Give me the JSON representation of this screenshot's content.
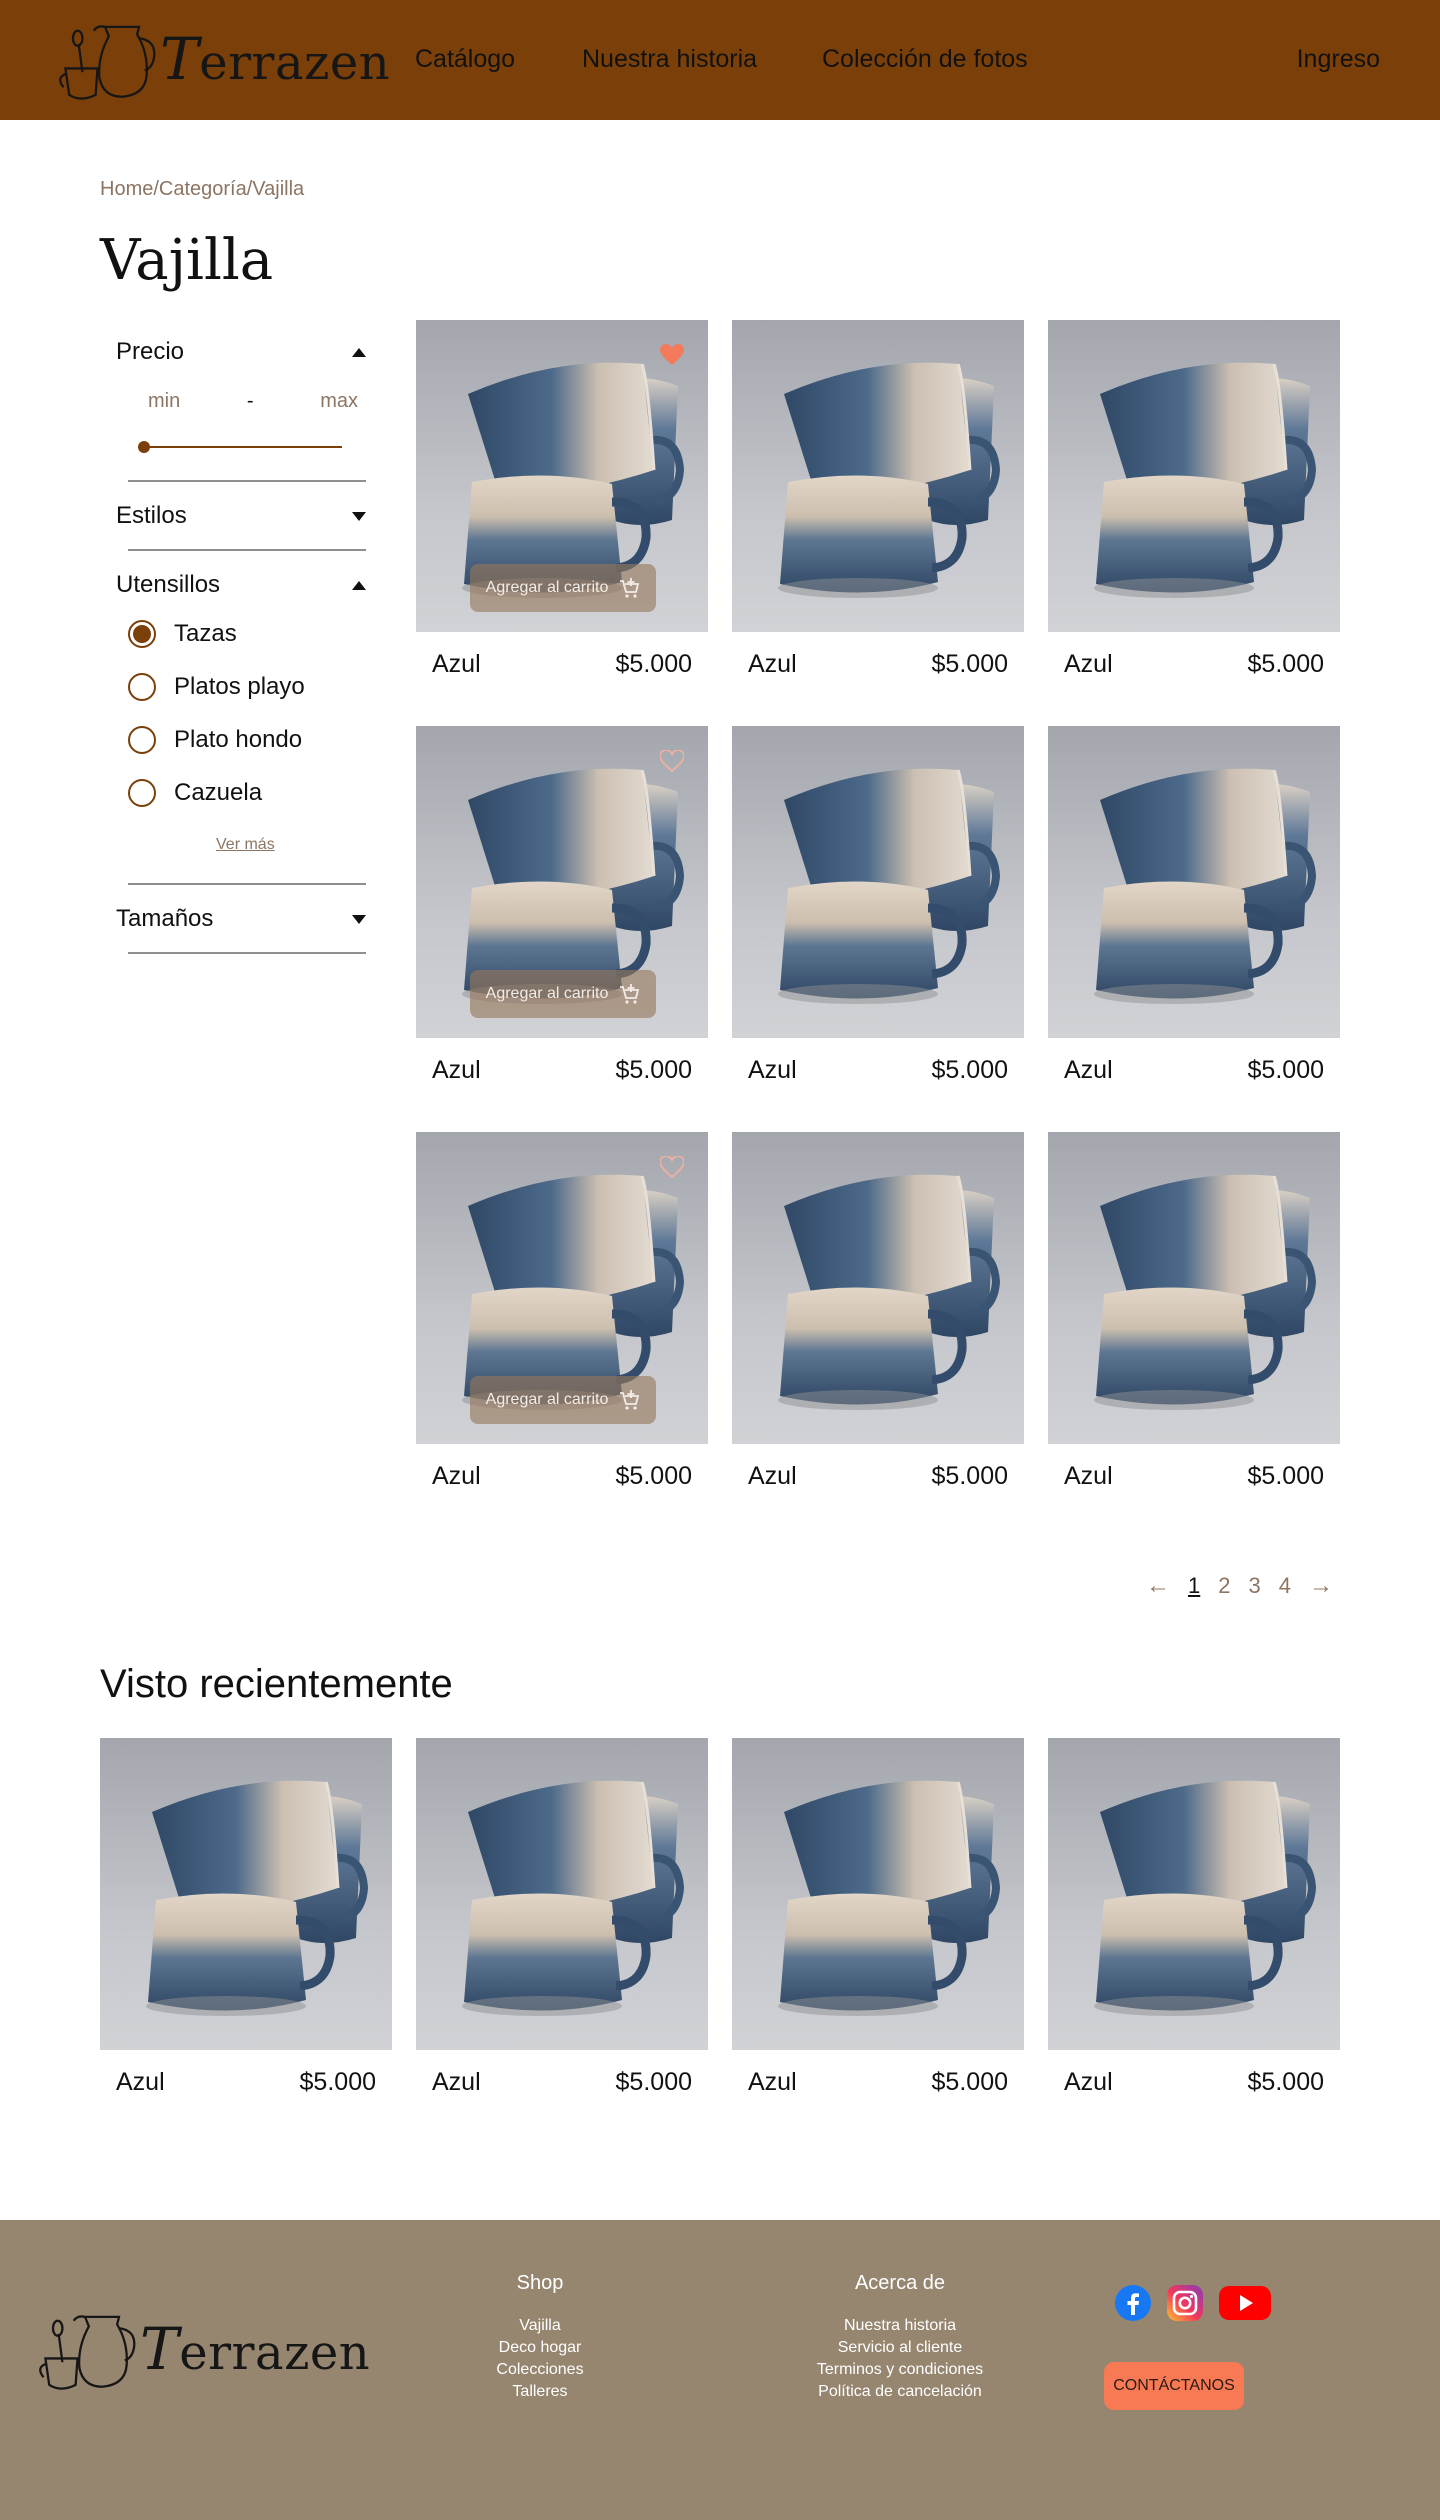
{
  "header": {
    "brand": "Terrazen",
    "nav": [
      "Catálogo",
      "Nuestra historia",
      "Colección de fotos"
    ],
    "login": "Ingreso"
  },
  "breadcrumb": [
    "Home/",
    "Categoría/",
    "Vajilla"
  ],
  "page_title": "Vajilla",
  "filters": {
    "price": {
      "label": "Precio",
      "min_placeholder": "min",
      "separator": "-",
      "max_placeholder": "max"
    },
    "styles": {
      "label": "Estilos"
    },
    "utensils": {
      "label": "Utensillos",
      "options": [
        "Tazas",
        "Platos playo",
        "Plato hondo",
        "Cazuela"
      ],
      "selected": "Tazas",
      "more": "Ver más"
    },
    "sizes": {
      "label": "Tamaños"
    }
  },
  "products": [
    {
      "name": "Azul",
      "price": "$5.000"
    },
    {
      "name": "Azul",
      "price": "$5.000"
    },
    {
      "name": "Azul",
      "price": "$5.000"
    },
    {
      "name": "Azul",
      "price": "$5.000"
    },
    {
      "name": "Azul",
      "price": "$5.000"
    },
    {
      "name": "Azul",
      "price": "$5.000"
    },
    {
      "name": "Azul",
      "price": "$5.000"
    },
    {
      "name": "Azul",
      "price": "$5.000"
    },
    {
      "name": "Azul",
      "price": "$5.000"
    }
  ],
  "add_to_cart_label": "Agregar al carrito",
  "pagination": {
    "pages": [
      "1",
      "2",
      "3",
      "4"
    ],
    "current": "1"
  },
  "recent": {
    "title": "Visto recientemente",
    "items": [
      {
        "name": "Azul",
        "price": "$5.000"
      },
      {
        "name": "Azul",
        "price": "$5.000"
      },
      {
        "name": "Azul",
        "price": "$5.000"
      },
      {
        "name": "Azul",
        "price": "$5.000"
      }
    ]
  },
  "footer": {
    "brand": "Terrazen",
    "shop": {
      "title": "Shop",
      "links": [
        "Vajilla",
        "Deco hogar",
        "Colecciones",
        "Talleres"
      ]
    },
    "about": {
      "title": "Acerca de",
      "links": [
        "Nuestra historia",
        "Servicio al cliente",
        "Terminos y condiciones",
        "Política de cancelación"
      ]
    },
    "social_icons": [
      "facebook-icon",
      "instagram-icon",
      "youtube-icon"
    ],
    "contact": "CONTÁCTANOS"
  },
  "colors": {
    "header_bg": "#7b4009",
    "footer_bg": "#968670",
    "accent": "#f87a55",
    "muted_text": "#8c7563"
  }
}
